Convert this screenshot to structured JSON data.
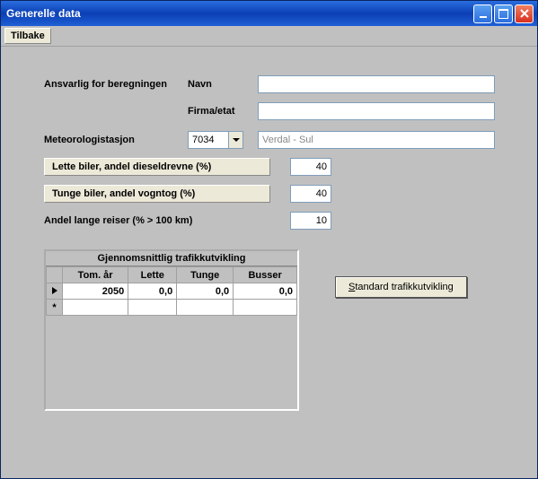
{
  "window": {
    "title": "Generelle data"
  },
  "toolbar": {
    "back_label": "Tilbake"
  },
  "form": {
    "ansvarlig_label": "Ansvarlig for beregningen",
    "navn_label": "Navn",
    "navn_value": "",
    "firma_label": "Firma/etat",
    "firma_value": "",
    "met_label": "Meteorologistasjon",
    "met_code": "7034",
    "met_name": "Verdal - Sul",
    "lette_btn": "Lette biler, andel dieseldrevne (%)",
    "lette_val": "40",
    "tunge_btn": "Tunge biler, andel vogntog (%)",
    "tunge_val": "40",
    "lange_label": "Andel lange reiser (% > 100 km)",
    "lange_val": "10"
  },
  "grid": {
    "title": "Gjennomsnittlig trafikkutvikling",
    "headers": {
      "tom": "Tom. år",
      "lette": "Lette",
      "tunge": "Tunge",
      "busser": "Busser"
    },
    "row": {
      "tom": "2050",
      "lette": "0,0",
      "tunge": "0,0",
      "busser": "0,0"
    }
  },
  "actions": {
    "standard_prefix": "S",
    "standard_rest": "tandard trafikkutvikling"
  }
}
